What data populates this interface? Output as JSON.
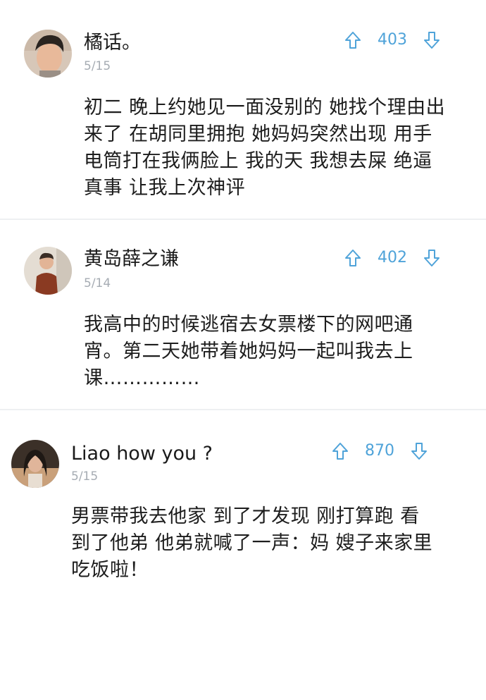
{
  "comments": [
    {
      "username": "橘话。",
      "date": "5/15",
      "votes": "403",
      "text": "初二 晚上约她见一面没别的 她找个理由出\n来了 在胡同里拥抱 她妈妈突然出现 用手\n电筒打在我俩脸上 我的天 我想去屎  绝逼\n真事 让我上次神评"
    },
    {
      "username": "黄岛薛之谦",
      "date": "5/14",
      "votes": "402",
      "text": "我高中的时候逃宿去女票楼下的网吧通\n宵。第二天她带着她妈妈一起叫我去上\n课……………"
    },
    {
      "username": "Liao how you ?",
      "date": "5/15",
      "votes": "870",
      "text": "男票带我去他家 到了才发现 刚打算跑 看\n到了他弟 他弟就喊了一声：妈 嫂子来家里\n吃饭啦！"
    }
  ],
  "icons": {
    "upvote": "arrow-up-outline-icon",
    "downvote": "arrow-down-outline-icon"
  },
  "colors": {
    "accent": "#4fa3d9",
    "date": "#a6acb3",
    "divider": "#eef0f2",
    "text": "#1d1d1d"
  }
}
